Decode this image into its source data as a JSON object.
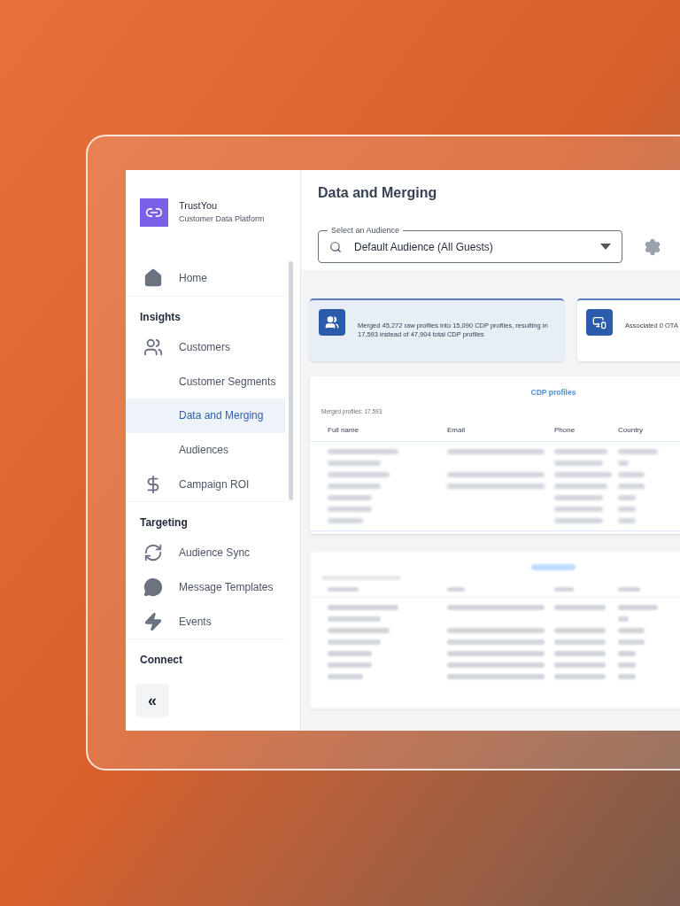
{
  "brand": {
    "name": "TrustYou",
    "subtitle": "Customer Data Platform"
  },
  "sidebar": {
    "items": [
      {
        "kind": "item",
        "label": "Home",
        "selected": false
      },
      {
        "kind": "header",
        "label": "Insights"
      },
      {
        "kind": "item",
        "label": "Customers",
        "selected": false
      },
      {
        "kind": "subitem",
        "label": "Customer Segments",
        "selected": false
      },
      {
        "kind": "subitem",
        "label": "Data and Merging",
        "selected": true
      },
      {
        "kind": "subitem",
        "label": "Audiences",
        "selected": false
      },
      {
        "kind": "item",
        "label": "Campaign ROI",
        "selected": false
      },
      {
        "kind": "header",
        "label": "Targeting"
      },
      {
        "kind": "item",
        "label": "Audience Sync",
        "selected": false
      },
      {
        "kind": "item",
        "label": "Message Templates",
        "selected": false
      },
      {
        "kind": "item",
        "label": "Events",
        "selected": false
      },
      {
        "kind": "header",
        "label": "Connect"
      }
    ],
    "collapse_button": "«"
  },
  "page": {
    "title": "Data and Merging",
    "audience_select": {
      "label": "Select an Audience",
      "value": "Default Audience (All Guests)"
    }
  },
  "cards": [
    {
      "text": "Merged 45,272 raw profiles into 15,090 CDP profiles, resulting in 17,593 instead of 47,904 total CDP profiles",
      "selected": true
    },
    {
      "text": "Associated 0 OTA",
      "selected": false
    }
  ],
  "table": {
    "title": "CDP profiles",
    "caption": "Merged profiles: 17,593",
    "columns": [
      "Full name",
      "Email",
      "Phone",
      "Country"
    ]
  }
}
